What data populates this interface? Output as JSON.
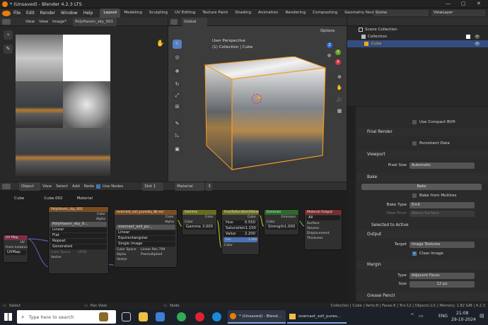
{
  "window": {
    "title": "* (Unsaved) - Blender 4.2.3 LTS"
  },
  "menu": [
    "File",
    "Edit",
    "Render",
    "Window",
    "Help"
  ],
  "workspaces": [
    "Layout",
    "Modeling",
    "Sculpting",
    "UV Editing",
    "Texture Paint",
    "Shading",
    "Animation",
    "Rendering",
    "Compositing",
    "Geometry Nodes",
    "Scr"
  ],
  "top_right": {
    "scene": "Scene",
    "view_layer": "ViewLayer"
  },
  "image_editor": {
    "view": "View",
    "view2": "View",
    "image": "Image*",
    "image_name": "PolyHaven_sky_001"
  },
  "viewport": {
    "mode": "Object Mode",
    "orientation": "Global",
    "options": "Options",
    "title": "User Perspective",
    "subtitle": "(1) Collection | Cube",
    "axis_x": "X",
    "axis_y": "Y",
    "axis_z": "Z"
  },
  "outliner": {
    "items": [
      "Scene Collection",
      "Collection",
      "Cube"
    ],
    "search_placeholder": "Search"
  },
  "properties": {
    "compact_bvh": "Use Compact BVH",
    "final_render": "Final Render",
    "persistent_data": "Persistent Data",
    "viewport": "Viewport",
    "pixel_size_label": "Pixel Size",
    "pixel_size": "Automatic",
    "bake": "Bake",
    "bake_button": "Bake",
    "bake_from_multires": "Bake from Multires",
    "bake_type_label": "Bake Type",
    "bake_type": "Emit",
    "view_from_label": "View From",
    "view_from": "Above Surface",
    "selected_to_active": "Selected to Active",
    "output": "Output",
    "target_label": "Target",
    "target": "Image Textures",
    "clear_image": "Clear Image",
    "margin": "Margin",
    "type_label": "Type",
    "type": "Adjacent Faces",
    "size_label": "Size",
    "size": "12 px",
    "grease_pencil": "Grease Pencil"
  },
  "node_editor": {
    "header": [
      "Object",
      "View",
      "Select",
      "Add",
      "Node",
      "Use Nodes",
      "Slot 1",
      "Material",
      "3"
    ],
    "breadcrumb": [
      "Cube",
      "Cube.002",
      "Material"
    ],
    "uvmap": {
      "title": "UV Map",
      "out": "UV",
      "from_instancer": "From Instancer",
      "uvmap": "UVMap"
    },
    "img1": {
      "title": "PolyHaven_sky_001",
      "color": "Color",
      "alpha": "Alpha",
      "name": "PolyHaven_sky_0...",
      "linear": "Linear",
      "flat": "Flat",
      "repeat": "Repeat",
      "generated": "Generated",
      "color_space": "Color Space",
      "color_space_val": "sRGB",
      "vector": "Vector"
    },
    "img2": {
      "title": "overcast_soil_puresky_8k.exr",
      "color": "Color",
      "alpha": "Alpha",
      "name": "overcast_soil_pu...",
      "linear": "Linear",
      "equi": "Equirectangular",
      "single": "Single Image",
      "color_space": "Color Space",
      "color_space_val": "Linear Rec.709",
      "alpha_label": "Alpha",
      "alpha_val": "Premultiplied",
      "vector": "Vector"
    },
    "gamma": {
      "title": "Gamma",
      "color": "Color",
      "color_in": "Color",
      "gamma_label": "Gamma",
      "gamma_val": "3.000"
    },
    "hsv": {
      "title": "Hue/Saturation/Value",
      "color": "Color",
      "hue_label": "Hue",
      "hue_val": "0.550",
      "sat_label": "Saturation",
      "sat_val": "1.150",
      "val_label": "Value",
      "val_val": "2.200",
      "fac_label": "Fac",
      "fac_val": "1.000",
      "color_in": "Color"
    },
    "emission": {
      "title": "Emission",
      "out": "Emission",
      "color": "Color",
      "strength_label": "Strength",
      "strength_val": "1.000"
    },
    "matout": {
      "title": "Material Output",
      "all": "All",
      "surface": "Surface",
      "volume": "Volume",
      "displacement": "Displacement",
      "thickness": "Thickness"
    }
  },
  "status": {
    "select": "Select",
    "pan": "Pan View",
    "node": "Node",
    "info": "Collection | Cube | Verts:8 | Faces:6 | Tris:12 | Objects:1/1 | Memory: 1.82 GiB | 4.2.3"
  },
  "taskbar": {
    "search": "Type here to search",
    "blender": "* (Unsaved) - Blend...",
    "folder": "overcast_soil_pures...",
    "lang": "ENG",
    "time": "21:08",
    "date": "29-10-2024"
  }
}
